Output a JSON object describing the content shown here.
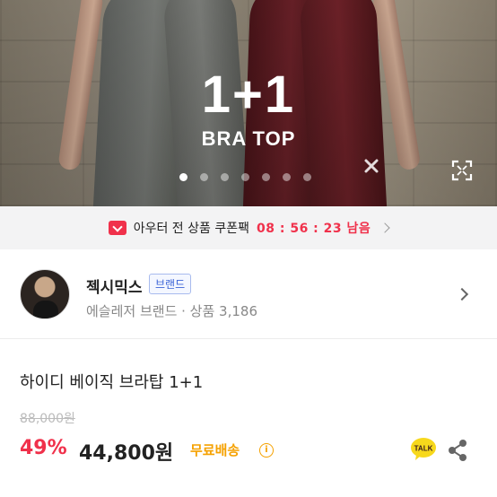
{
  "hero": {
    "title": "1+1",
    "subtitle": "BRA TOP",
    "slide_count": 7,
    "active_slide": 1
  },
  "coupon": {
    "label": "아우터 전 상품 쿠폰팩",
    "timer": "08 : 56 : 23 남음"
  },
  "shop": {
    "name": "젝시믹스",
    "badge": "브랜드",
    "meta": "에슬레저 브랜드 · 상품 3,186"
  },
  "product": {
    "name": "하이디 베이직 브라탑 1+1",
    "original_price": "88,000원",
    "discount": "49%",
    "price": "44,800원",
    "shipping": "무료배송"
  },
  "colors": {
    "accent_red": "#f0314b",
    "shipping_orange": "#f5a100",
    "badge_blue": "#3b64d7",
    "talk_yellow": "#f7d81c"
  },
  "icons": [
    "expand-icon",
    "coupon-icon",
    "chevron-right-icon",
    "info-icon",
    "kakaotalk-icon",
    "share-icon"
  ]
}
